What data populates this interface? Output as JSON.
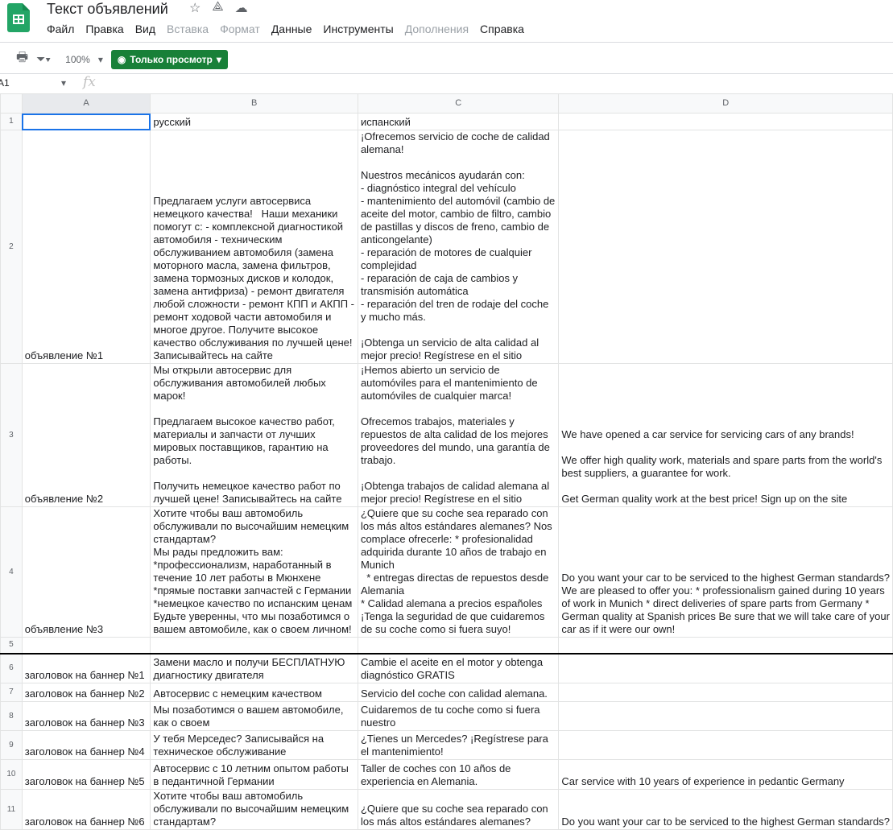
{
  "doc": {
    "title": "Текст объявлений"
  },
  "menu": [
    "Файл",
    "Правка",
    "Вид",
    "Вставка",
    "Формат",
    "Данные",
    "Инструменты",
    "Дополнения",
    "Справка"
  ],
  "toolbar": {
    "zoom": "100%",
    "view_only": "Только просмотр"
  },
  "formula_bar": {
    "cell": "A1",
    "fx": "fx"
  },
  "columns": [
    "A",
    "B",
    "C",
    "D"
  ],
  "rows": [
    {
      "n": "1",
      "a": "",
      "b": "русский",
      "c": "испанский",
      "d": ""
    },
    {
      "n": "2",
      "a": "объявление №1",
      "b": "Предлагаем услуги автосервиса немецкого качества!   Наши механики помогут с: - комплексной диагностикой автомобиля - техническим обслуживанием автомобиля (замена моторного масла, замена фильтров, замена тормозных дисков и колодок, замена антифриза) - ремонт двигателя любой сложности - ремонт КПП и АКПП - ремонт ходовой части автомобиля и многое другое. Получите высокое качество обслуживания по лучшей цене! Записывайтесь на сайте",
      "c": "¡Ofrecemos servicio de coche de calidad alemana!\n\nNuestros mecánicos ayudarán con:\n- diagnóstico integral del vehículo\n- mantenimiento del automóvil (cambio de aceite del motor, cambio de filtro, cambio de pastillas y discos de freno, cambio de anticongelante)\n- reparación de motores de cualquier complejidad\n- reparación de caja de cambios y transmisión automática\n- reparación del tren de rodaje del coche\ny mucho más.\n\n¡Obtenga un servicio de alta calidad al mejor precio! Regístrese en el sitio",
      "d": ""
    },
    {
      "n": "3",
      "a": "объявление №2",
      "b": "Мы открыли автосервис для обслуживания автомобилей любых марок!\n\nПредлагаем высокое качество работ, материалы и запчасти от лучших мировых поставщиков, гарантию на работы.\n\nПолучить немецкое качество работ по лучшей цене! Записывайтесь на сайте",
      "c": "¡Hemos abierto un servicio de automóviles para el mantenimiento de automóviles de cualquier marca!\n\nOfrecemos trabajos, materiales y repuestos de alta calidad de los mejores proveedores del mundo, una garantía de trabajo.\n\n¡Obtenga trabajos de calidad alemana al mejor precio! Regístrese en el sitio",
      "d": "We have opened a car service for servicing cars of any brands!\n\nWe offer high quality work, materials and spare parts from the world's best suppliers, a guarantee for work.\n\nGet German quality work at the best price! Sign up on the site"
    },
    {
      "n": "4",
      "a": "объявление №3",
      "b": "Хотите чтобы ваш автомобиль обслуживали по высочайшим немецким стандартам?\nМы рады предложить вам:\n*профессионализм, наработанный в течение 10 лет работы в Мюнхене\n*прямые поставки запчастей с Германии\n*немецкое качество по испанским ценам\nБудьте уверенны, что мы позаботимся о вашем автомобиле, как о своем личном!",
      "c": "¿Quiere que su coche sea reparado con los más altos estándares alemanes? Nos complace ofrecerle: * profesionalidad adquirida durante 10 años de trabajo en Munich\n  * entregas directas de repuestos desde Alemania\n* Calidad alemana a precios españoles\n¡Tenga la seguridad de que cuidaremos de su coche como si fuera suyo!",
      "d": "Do you want your car to be serviced to the highest German standards? We are pleased to offer you: * professionalism gained during 10 years of work in Munich * direct deliveries of spare parts from Germany * German quality at Spanish prices Be sure that we will take care of your car as if it were our own!"
    },
    {
      "n": "5",
      "a": "",
      "b": "",
      "c": "",
      "d": ""
    },
    {
      "n": "6",
      "a": "заголовок на баннер №1",
      "b": "Замени масло и получи БЕСПЛАТНУЮ диагностику двигателя",
      "c": "Cambie el aceite en el motor y obtenga diagnóstico GRATIS",
      "d": ""
    },
    {
      "n": "7",
      "a": "заголовок на баннер №2",
      "b": "Автосервис с немецким качеством",
      "c": "Servicio del coche con calidad alemana.",
      "d": ""
    },
    {
      "n": "8",
      "a": "заголовок на баннер №3",
      "b": "Мы позаботимся о вашем автомобиле, как о своем",
      "c": "Cuidaremos de tu coche como si fuera nuestro",
      "d": ""
    },
    {
      "n": "9",
      "a": "заголовок на баннер №4",
      "b": "У тебя Мерседес? Записывайся на техническое обслуживание",
      "c": "¿Tienes un Mercedes? ¡Regístrese para el mantenimiento!",
      "d": ""
    },
    {
      "n": "10",
      "a": "заголовок на баннер №5",
      "b": "Автосервис с 10 летним опытом работы в педантичной Германии",
      "c": "Taller de coches con 10 años de experiencia en Alemania.",
      "d": "Car service with 10 years of experience in pedantic Germany"
    },
    {
      "n": "11",
      "a": "заголовок на баннер №6",
      "b": "Хотите чтобы ваш автомобиль обслуживали по высочайшим немецким стандартам?",
      "c": "¿Quiere que su coche sea reparado con los más altos estándares alemanes?",
      "d": "Do you want your car to be serviced to the highest German standards?"
    }
  ]
}
